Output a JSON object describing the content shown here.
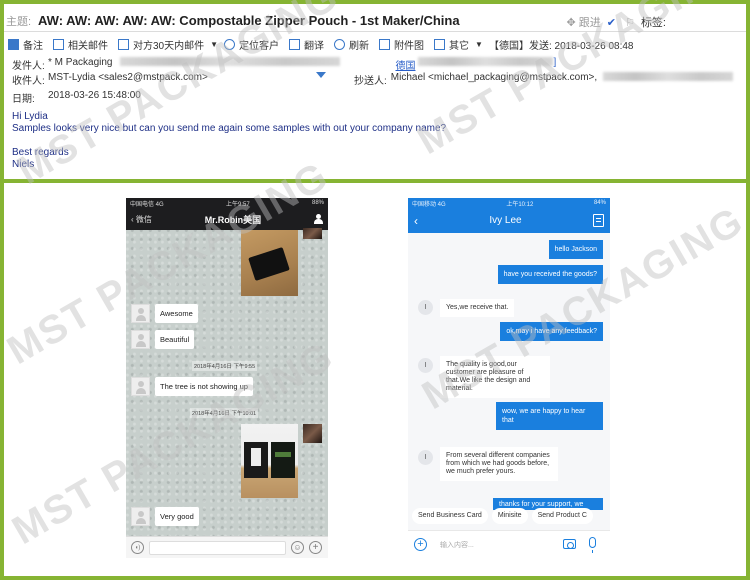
{
  "email": {
    "subject_label": "主题:",
    "subject": "AW: AW: AW: AW: AW: Compostable Zipper Pouch - 1st Maker/China",
    "follow_label": "跟进",
    "tags_label": "标签:",
    "toolbar": [
      {
        "icon": "note-icon",
        "label": "备注"
      },
      {
        "icon": "related-mail-icon",
        "label": "相关邮件"
      },
      {
        "icon": "mail-30days-icon",
        "label": "对方30天内邮件"
      },
      {
        "icon": "locate-customer-icon",
        "label": "定位客户"
      },
      {
        "icon": "translate-icon",
        "label": "翻译"
      },
      {
        "icon": "refresh-icon",
        "label": "刷新"
      },
      {
        "icon": "attachment-image-icon",
        "label": "附件图"
      },
      {
        "icon": "other-icon",
        "label": "其它"
      }
    ],
    "sent_info": "【德国】发送: 2018-03-26 08:48",
    "from_label": "发件人:",
    "from_value": "*   M Packaging",
    "from_country_link": "德国",
    "to_label": "收件人:",
    "to_value": "MST-Lydia <sales2@mstpack.com>",
    "cc_label": "抄送人:",
    "cc_value": "Michael <michael_packaging@mstpack.com>,",
    "date_label": "日期:",
    "date_value": "2018-03-26 15:48:00",
    "body": {
      "greeting": "Hi Lydia",
      "message": "Samples looks very nice but can you send me again some samples with out your company name?",
      "closing": "Best regards",
      "signature": "Niels"
    }
  },
  "watermark": "MST PACKAGING",
  "wechat": {
    "status": {
      "carrier": "中国电信  4G",
      "time": "上午9:57",
      "battery": "88%"
    },
    "back_label": "微信",
    "title": "Mr.Robin美国",
    "messages": [
      {
        "type": "image",
        "from": "me",
        "content": "black-pouch-photo"
      },
      {
        "type": "text",
        "from": "other",
        "text": "Awesome"
      },
      {
        "type": "text",
        "from": "other",
        "text": "Beautiful"
      },
      {
        "type": "timestamp",
        "text": "2018年4月16日 下午9:55"
      },
      {
        "type": "text",
        "from": "other",
        "text": "The tree is not showing up"
      },
      {
        "type": "timestamp",
        "text": "2018年4月16日 下午10:01"
      },
      {
        "type": "image",
        "from": "me",
        "content": "two-pouches-photo"
      },
      {
        "type": "text",
        "from": "other",
        "text": "Very good"
      }
    ]
  },
  "chat2": {
    "status": {
      "carrier": "中国移动  4G",
      "time": "上午10:12",
      "battery": "84%"
    },
    "title": "Ivy Lee",
    "avatar_initial": "I",
    "messages": [
      {
        "from": "me",
        "text": "hello Jackson"
      },
      {
        "from": "me",
        "text": "have you received the goods?"
      },
      {
        "from": "other",
        "text": "Yes,we receive that."
      },
      {
        "from": "me",
        "text": "ok,may i have any feedback?"
      },
      {
        "from": "other",
        "text": "The quality is good,our customer are pleasure of that.We like the design and material."
      },
      {
        "from": "me",
        "text": "wow, we are happy to hear that"
      },
      {
        "from": "other",
        "text": "From several different companies from which we had goods before, we much prefer yours."
      },
      {
        "from": "me",
        "text": "thanks for your support, we"
      }
    ],
    "quick_actions": [
      "Send Business Card",
      "Minisite",
      "Send Product C"
    ],
    "input_placeholder": "输入内容..."
  },
  "colors": {
    "frame_green": "#86b433",
    "chat_blue": "#1a7fde",
    "wechat_dark": "#1d1d1f",
    "email_body_text": "#1e2f86"
  }
}
